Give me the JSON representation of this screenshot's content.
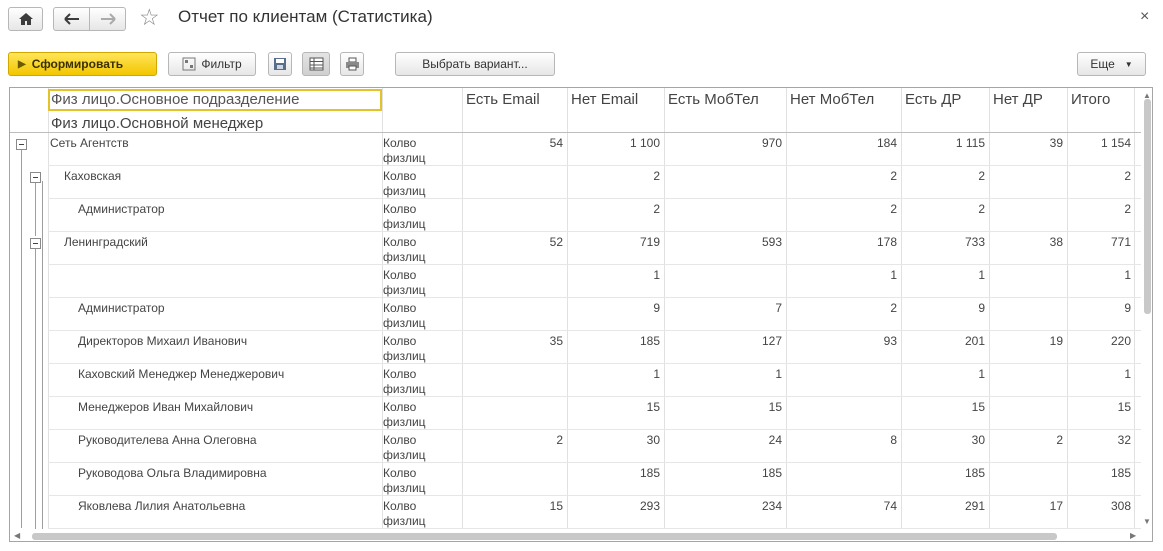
{
  "window": {
    "title": "Отчет по клиентам (Статистика)",
    "close_glyph": "×"
  },
  "nav": {
    "home_icon": "home-icon",
    "back_icon": "arrow-left-icon",
    "forward_icon": "arrow-right-icon",
    "favorite_icon": "star-icon"
  },
  "toolbar": {
    "generate_label": "Сформировать",
    "filter_label": "Фильтр",
    "choose_variant_label": "Выбрать вариант...",
    "more_label": "Еще"
  },
  "report": {
    "group_header_1": "Физ лицо.Основное подразделение",
    "group_header_2": "Физ лицо.Основной менеджер",
    "columns": [
      "Есть Email",
      "Нет Email",
      "Есть МобТел",
      "Нет МобТел",
      "Есть ДР",
      "Нет ДР",
      "Итого"
    ],
    "rows": [
      {
        "name": "Сеть Агентств",
        "measure_1": "Колво",
        "measure_2": "физлиц",
        "values": [
          "54",
          "1 100",
          "970",
          "184",
          "1 115",
          "39",
          "1 154"
        ]
      },
      {
        "name": "Каховская",
        "measure_1": "Колво",
        "measure_2": "физлиц",
        "values": [
          "",
          "2",
          "",
          "2",
          "2",
          "",
          "2"
        ]
      },
      {
        "name": "Администратор",
        "measure_1": "Колво",
        "measure_2": "физлиц",
        "values": [
          "",
          "2",
          "",
          "2",
          "2",
          "",
          "2"
        ]
      },
      {
        "name": "Ленинградский",
        "measure_1": "Колво",
        "measure_2": "физлиц",
        "values": [
          "52",
          "719",
          "593",
          "178",
          "733",
          "38",
          "771"
        ]
      },
      {
        "name": "",
        "measure_1": "Колво",
        "measure_2": "физлиц",
        "values": [
          "",
          "1",
          "",
          "1",
          "1",
          "",
          "1"
        ]
      },
      {
        "name": "Администратор",
        "measure_1": "Колво",
        "measure_2": "физлиц",
        "values": [
          "",
          "9",
          "7",
          "2",
          "9",
          "",
          "9"
        ]
      },
      {
        "name": "Директоров Михаил Иванович",
        "measure_1": "Колво",
        "measure_2": "физлиц",
        "values": [
          "35",
          "185",
          "127",
          "93",
          "201",
          "19",
          "220"
        ]
      },
      {
        "name": "Каховский Менеджер Менеджерович",
        "measure_1": "Колво",
        "measure_2": "физлиц",
        "values": [
          "",
          "1",
          "1",
          "",
          "1",
          "",
          "1"
        ]
      },
      {
        "name": "Менеджеров Иван Михайлович",
        "measure_1": "Колво",
        "measure_2": "физлиц",
        "values": [
          "",
          "15",
          "15",
          "",
          "15",
          "",
          "15"
        ]
      },
      {
        "name": "Руководителева Анна Олеговна",
        "measure_1": "Колво",
        "measure_2": "физлиц",
        "values": [
          "2",
          "30",
          "24",
          "8",
          "30",
          "2",
          "32"
        ]
      },
      {
        "name": "Руководова Ольга Владимировна",
        "measure_1": "Колво",
        "measure_2": "физлиц",
        "values": [
          "",
          "185",
          "185",
          "",
          "185",
          "",
          "185"
        ]
      },
      {
        "name": "Яковлева Лилия Анатольевна",
        "measure_1": "Колво",
        "measure_2": "физлиц",
        "values": [
          "15",
          "293",
          "234",
          "74",
          "291",
          "17",
          "308"
        ]
      }
    ]
  }
}
